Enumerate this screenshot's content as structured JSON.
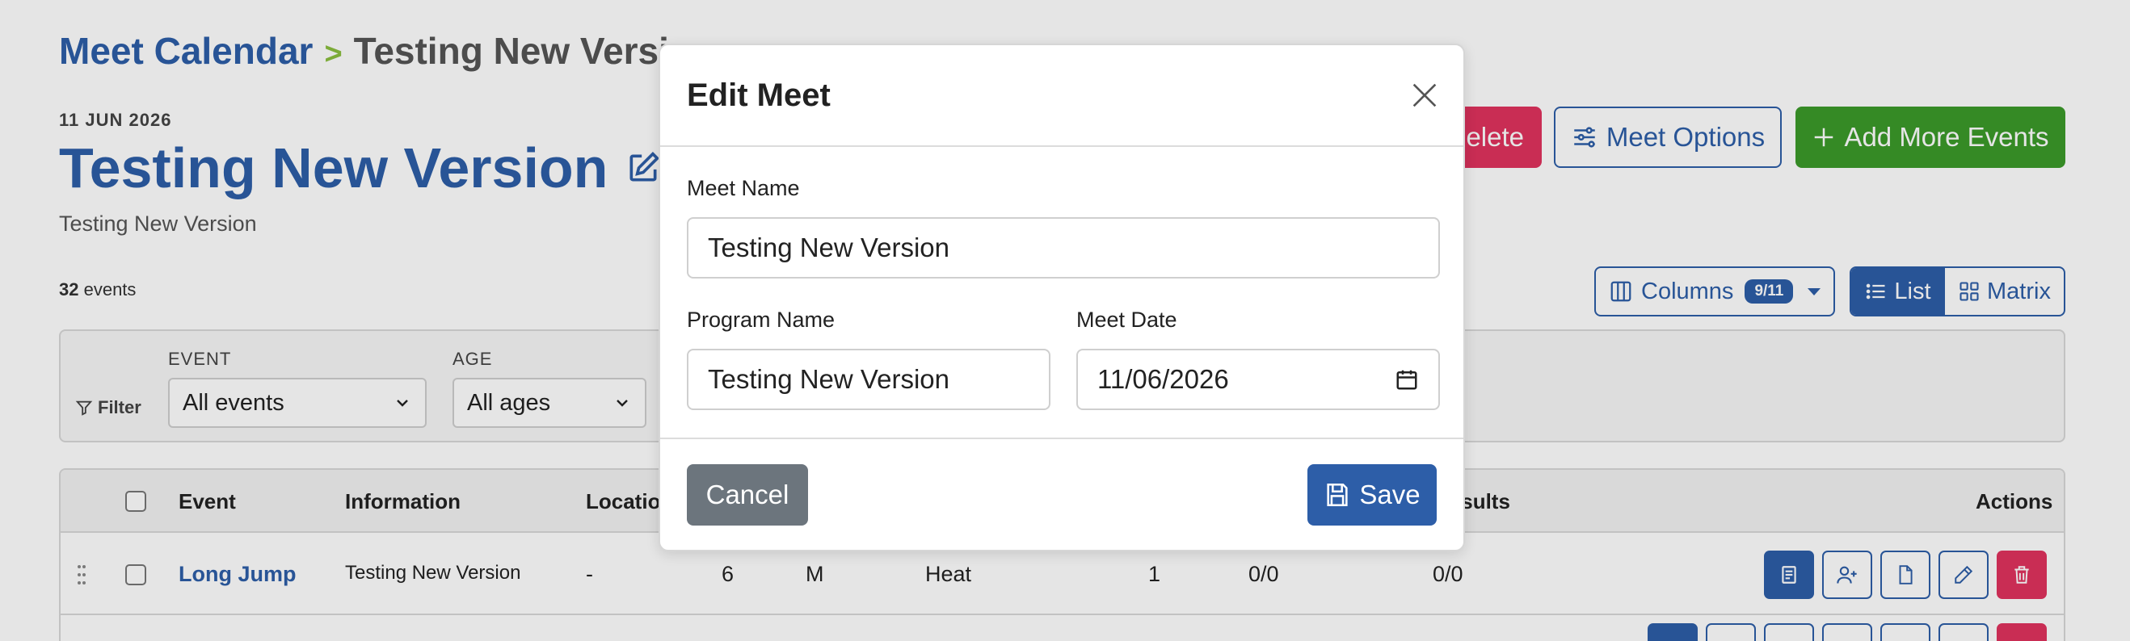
{
  "breadcrumb": {
    "root": "Meet Calendar",
    "separator": ">",
    "current": "Testing New Version"
  },
  "meet": {
    "date": "11 JUN 2026",
    "title": "Testing New Version",
    "subtitle": "Testing New Version",
    "event_count": "32",
    "event_count_suffix": " events"
  },
  "toolbar": {
    "delete_label": "Delete",
    "options_label": "Meet Options",
    "add_label": "Add More Events",
    "columns_label": "Columns",
    "columns_badge": "9/11",
    "view_list_label": "List",
    "view_matrix_label": "Matrix"
  },
  "filters": {
    "filter_label": "Filter",
    "event": {
      "label": "EVENT",
      "value": "All events"
    },
    "age": {
      "label": "AGE",
      "value": "All ages"
    }
  },
  "table": {
    "headers": {
      "event": "Event",
      "information": "Information",
      "location": "Location",
      "results": "Results",
      "actions": "Actions"
    },
    "rows": [
      {
        "event": "Long Jump",
        "information": "Testing New Version",
        "location": "-",
        "age": "6",
        "gender": "M",
        "type": "Heat",
        "round": "1",
        "entries": "0/0",
        "results": "0/0"
      }
    ]
  },
  "modal": {
    "title": "Edit Meet",
    "meet_name_label": "Meet Name",
    "meet_name_value": "Testing New Version",
    "program_name_label": "Program Name",
    "program_name_value": "Testing New Version",
    "meet_date_label": "Meet Date",
    "meet_date_value": "11/06/2026",
    "cancel_label": "Cancel",
    "save_label": "Save"
  },
  "colors": {
    "primary": "#2d5ea8",
    "danger": "#e0335e",
    "success": "#3c9a2a",
    "secondary": "#6c757d",
    "accent_green": "#8bbf3f"
  }
}
